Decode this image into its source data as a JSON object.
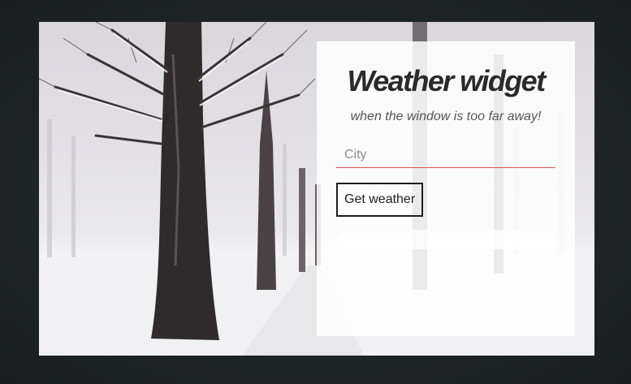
{
  "widget": {
    "title": "Weather widget",
    "subtitle": "when the window is too far away!",
    "city_placeholder": "City",
    "city_value": "",
    "button_label": "Get weather",
    "result_text": ""
  },
  "colors": {
    "page_background": "#1f2426",
    "input_underline": "#d9534f",
    "button_border": "#1e1e1e",
    "title_text": "#2a2a2a"
  },
  "icons": {
    "background": "snowy-tree-lined-road-photo"
  }
}
